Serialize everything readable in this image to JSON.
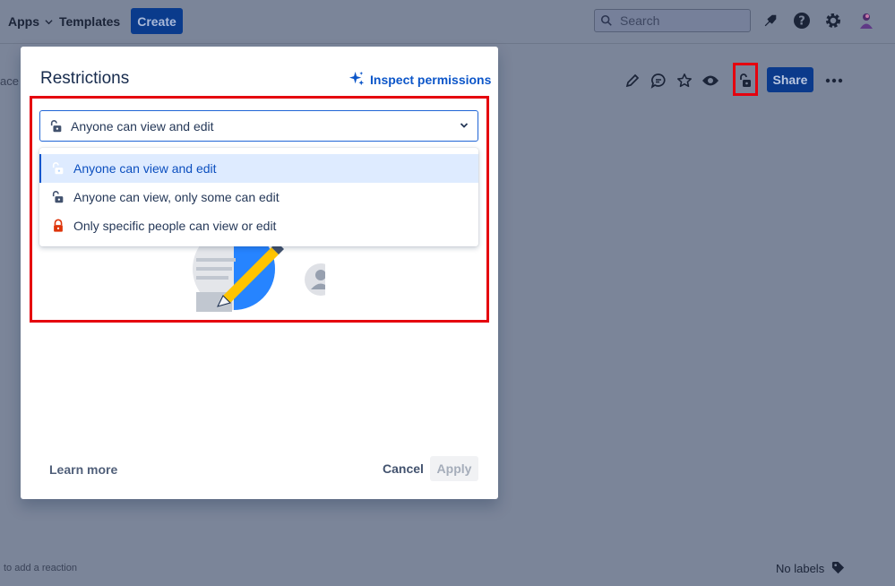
{
  "nav": {
    "apps_label": "Apps",
    "templates_label": "Templates",
    "create_label": "Create",
    "search_placeholder": "Search"
  },
  "page": {
    "space_fragment": "ace",
    "share_label": "Share",
    "reaction_hint": "to add a reaction",
    "labels_text": "No labels"
  },
  "modal": {
    "title": "Restrictions",
    "inspect_label": "Inspect permissions",
    "selected_value": "Anyone can view and edit",
    "options": [
      {
        "label": "Anyone can view and edit",
        "icon": "unlock-icon"
      },
      {
        "label": "Anyone can view, only some can edit",
        "icon": "lock-partial-icon"
      },
      {
        "label": "Only specific people can view or edit",
        "icon": "lock-icon"
      }
    ],
    "learn_more_label": "Learn more",
    "cancel_label": "Cancel",
    "apply_label": "Apply"
  },
  "colors": {
    "accent": "#0c56c9",
    "highlight": "#e5000e",
    "restricted": "#de350b",
    "overlay": "#7b8599"
  }
}
